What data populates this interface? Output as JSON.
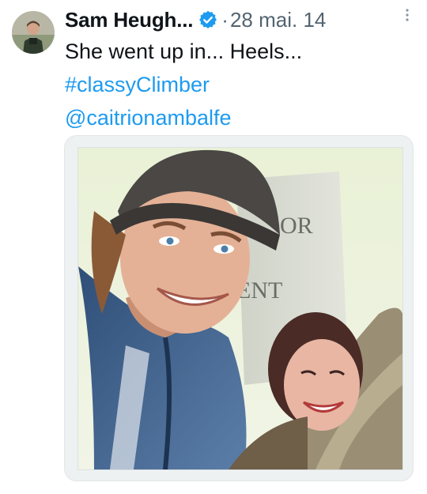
{
  "tweet": {
    "author_name": "Sam Heugh...",
    "separator": "·",
    "date": "28 mai. 14",
    "text": "She went up in... Heels...",
    "hashtag": "#classyClimber",
    "mention": "@caitrionambalfe"
  },
  "icons": {
    "verified": "verified-badge-icon",
    "more": "more-vertical-icon"
  },
  "colors": {
    "link": "#1d9bf0",
    "verified": "#1d9bf0",
    "text": "#0f1419",
    "secondary": "#536471"
  }
}
